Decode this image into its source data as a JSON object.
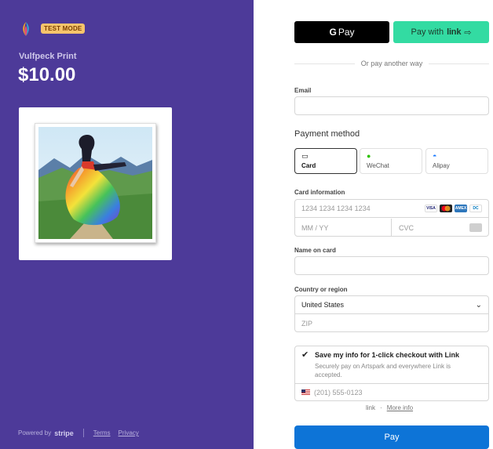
{
  "merchant": {
    "test_badge": "TEST MODE"
  },
  "product": {
    "name": "Vulfpeck Print",
    "price": "$10.00"
  },
  "footer": {
    "powered_by": "Powered by",
    "brand": "stripe",
    "terms": "Terms",
    "privacy": "Privacy"
  },
  "express": {
    "gpay_g": "G",
    "gpay_label": "Pay",
    "link_label": "Pay with",
    "link_brand": "link",
    "link_arrow": "⇨"
  },
  "divider_text": "Or pay another way",
  "email": {
    "label": "Email",
    "value": ""
  },
  "payment_method": {
    "title": "Payment method",
    "options": [
      {
        "label": "Card",
        "icon": "card-icon"
      },
      {
        "label": "WeChat",
        "icon": "wechat-icon"
      },
      {
        "label": "Alipay",
        "icon": "alipay-icon"
      }
    ]
  },
  "card": {
    "label": "Card information",
    "number_placeholder": "1234 1234 1234 1234",
    "expiry_placeholder": "MM / YY",
    "cvc_placeholder": "CVC",
    "brands": [
      "VISA",
      "MC",
      "AMEX",
      "DC"
    ]
  },
  "name": {
    "label": "Name on card",
    "value": ""
  },
  "country": {
    "label": "Country or region",
    "selected": "United States",
    "zip_placeholder": "ZIP"
  },
  "link_save": {
    "title": "Save my info for 1-click checkout with Link",
    "description": "Securely pay on Artspark and everywhere Link is accepted.",
    "phone_placeholder": "(201) 555-0123"
  },
  "link_info": {
    "brand": "link",
    "more": "More info"
  },
  "pay_button": "Pay",
  "colors": {
    "left_bg": "#4d3a99",
    "link_green": "#33dba2",
    "pay_blue": "#0d74d7",
    "badge": "#f6c46b"
  }
}
